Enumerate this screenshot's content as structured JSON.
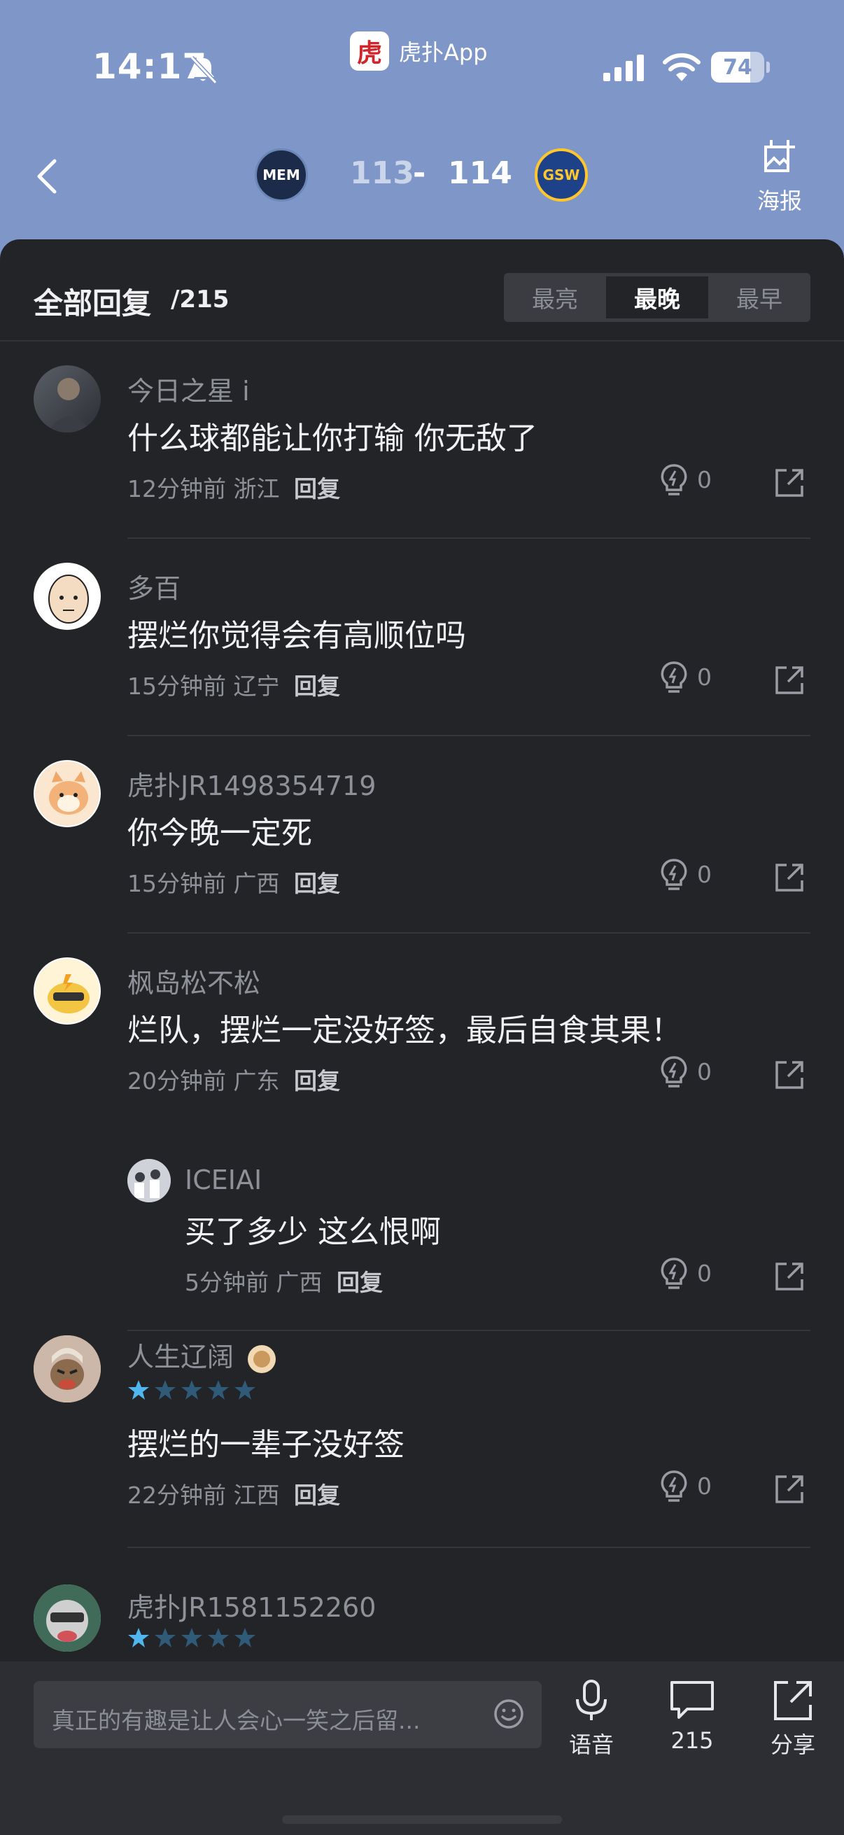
{
  "status_bar": {
    "time": "14:17",
    "app_name": "虎扑App",
    "app_logo_text": "虎",
    "battery": "74"
  },
  "game": {
    "home_team": "MEM",
    "away_team": "GSW",
    "home_score": "113",
    "dash": "-",
    "away_score": "114",
    "poster_label": "海报"
  },
  "panel": {
    "title": "全部回复",
    "count": "/215",
    "sort_options": [
      "最亮",
      "最晚",
      "最早"
    ],
    "active_sort": "最晚"
  },
  "comments": [
    {
      "user": "今日之星 i",
      "text": "什么球都能让你打输 你无敌了",
      "time": "12分钟前",
      "region": "浙江",
      "reply_label": "回复",
      "likes": "0",
      "rating": null
    },
    {
      "user": "多百",
      "text": "摆烂你觉得会有高顺位吗",
      "time": "15分钟前",
      "region": "辽宁",
      "reply_label": "回复",
      "likes": "0",
      "rating": null
    },
    {
      "user": "虎扑JR1498354719",
      "text": "你今晚一定死",
      "time": "15分钟前",
      "region": "广西",
      "reply_label": "回复",
      "likes": "0",
      "rating": null
    },
    {
      "user": "枫岛松不松",
      "text": "烂队，摆烂一定没好签，最后自食其果！",
      "time": "20分钟前",
      "region": "广东",
      "reply_label": "回复",
      "likes": "0",
      "rating": null,
      "nested_reply": {
        "user": "ICEIAI",
        "text": "买了多少 这么恨啊",
        "time": "5分钟前",
        "region": "广西",
        "reply_label": "回复",
        "likes": "0"
      }
    },
    {
      "user": "人生辽阔",
      "text": "摆烂的一辈子没好签",
      "time": "22分钟前",
      "region": "江西",
      "reply_label": "回复",
      "likes": "0",
      "rating": 1
    },
    {
      "user": "虎扑JR1581152260",
      "rating": 1
    }
  ],
  "bottom_bar": {
    "input_placeholder": "真正的有趣是让人会心一笑之后留...",
    "voice_label": "语音",
    "comment_count": "215",
    "share_label": "分享"
  },
  "colors": {
    "header_bg": "#7e96c8",
    "panel_bg": "#232427",
    "star_active": "#4fb6f0",
    "star_inactive": "#2f5a78"
  }
}
